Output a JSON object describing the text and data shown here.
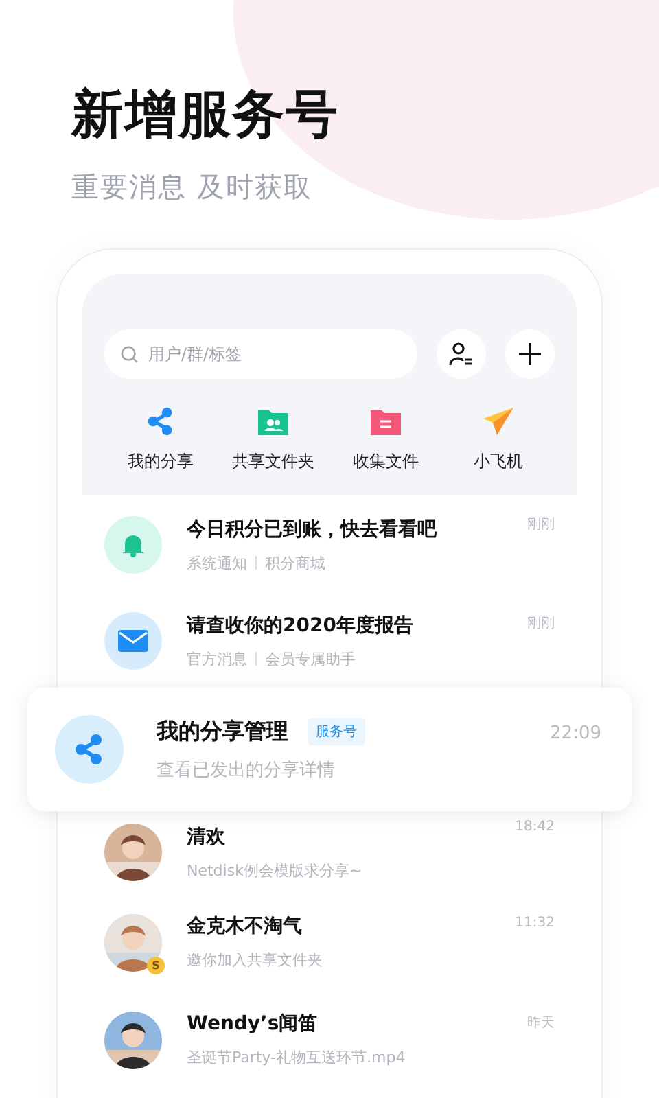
{
  "headline": "新增服务号",
  "subline": "重要消息 及时获取",
  "search": {
    "placeholder": "用户/群/标签"
  },
  "shortcuts": [
    {
      "kind": "share",
      "label": "我的分享"
    },
    {
      "kind": "shared-folder",
      "label": "共享文件夹"
    },
    {
      "kind": "collect",
      "label": "收集文件"
    },
    {
      "kind": "plane",
      "label": "小飞机"
    }
  ],
  "messages": [
    {
      "kind": "bell",
      "title": "今日积分已到账，快去看看吧",
      "source": "系统通知",
      "sender": "积分商城",
      "time": "刚刚"
    },
    {
      "kind": "mail",
      "title": "请查收你的2020年度报告",
      "source": "官方消息",
      "sender": "会员专属助手",
      "time": "刚刚"
    }
  ],
  "featured": {
    "title": "我的分享管理",
    "tag": "服务号",
    "preview": "查看已发出的分享详情",
    "time": "22:09"
  },
  "chats": [
    {
      "name": "清欢",
      "preview": "Netdisk例会模版求分享~",
      "time": "18:42"
    },
    {
      "name": "金克木不淘气",
      "preview": "邀你加入共享文件夹",
      "time": "11:32",
      "badge": "S"
    },
    {
      "name": "Wendy’s闻笛",
      "preview": "圣诞节Party-礼物互送环节.mp4",
      "time": "昨天"
    }
  ]
}
